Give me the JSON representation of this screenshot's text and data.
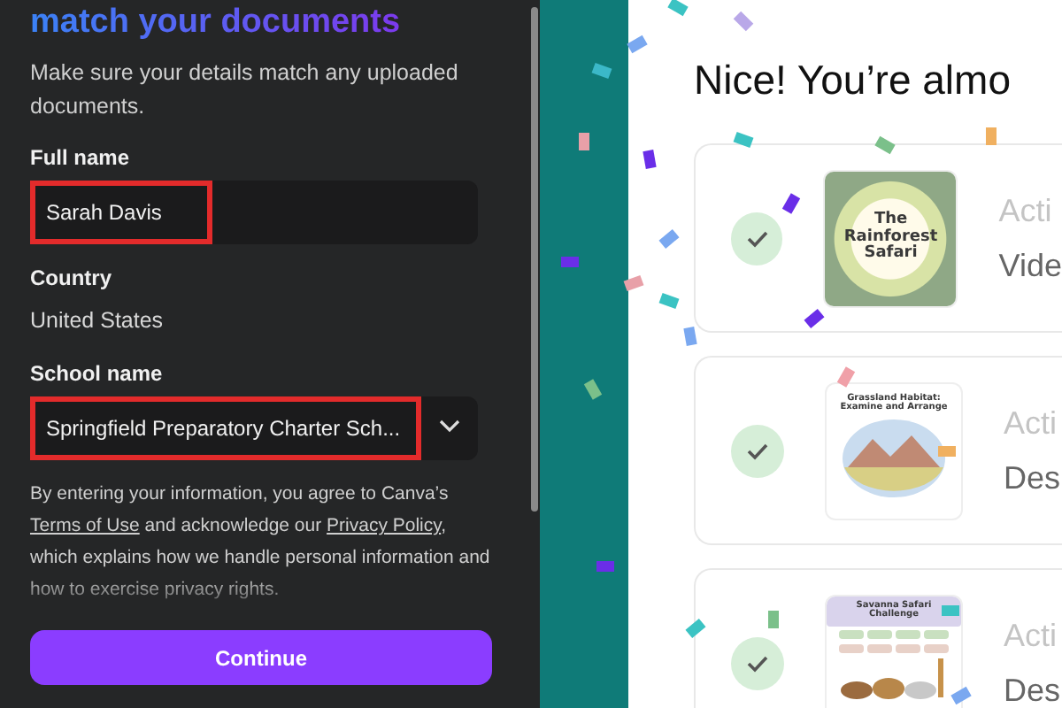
{
  "form": {
    "heading": "match your documents",
    "description": "Make sure your details match any uploaded documents.",
    "fields": [
      {
        "kind": "input",
        "label": "Full name",
        "value": "Sarah Davis",
        "highlighted": true
      },
      {
        "kind": "static",
        "label": "Country",
        "value": "United States",
        "highlighted": false
      },
      {
        "kind": "select",
        "label": "School name",
        "value": "Springfield Preparatory Charter Sch...",
        "highlighted": true
      }
    ],
    "legal": {
      "before": "By entering your information, you agree to Canva’s",
      "terms_link": "Terms of Use",
      "middle": "and acknowledge our",
      "privacy_link": "Privacy Policy",
      "after": ", which explains how we handle personal information and how to exercise privacy rights."
    },
    "continue_button": "Continue"
  },
  "progress": {
    "heading": "Nice! You’re almo",
    "items": [
      {
        "checked": true,
        "thumbnail_title": "The Rainforest Safari",
        "label": "Acti",
        "type": "Vide"
      },
      {
        "checked": true,
        "thumbnail_title": "Grassland Habitat: Examine and Arrange",
        "label": "Acti",
        "type": "Des"
      },
      {
        "checked": true,
        "thumbnail_title": "Savanna Safari Challenge",
        "label": "Acti",
        "type": "Des"
      }
    ]
  }
}
